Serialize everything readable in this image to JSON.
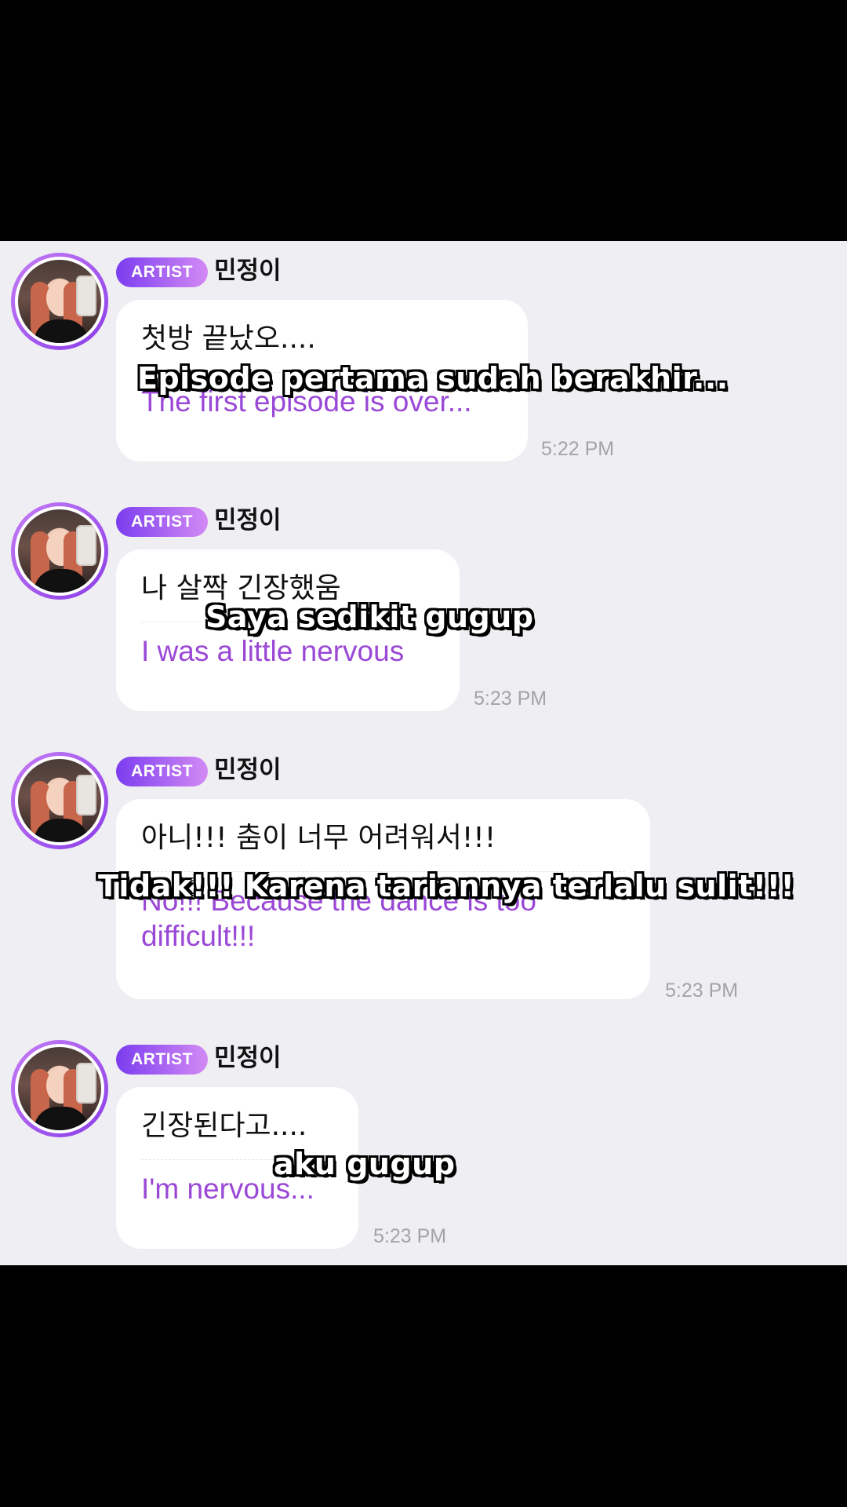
{
  "messages": [
    {
      "badge": "ARTIST",
      "name": "민정이",
      "korean": "첫방 끝났오....",
      "english": "The first episode is over...",
      "time": "5:22 PM",
      "subtitle": "Episode pertama sudah berakhir..."
    },
    {
      "badge": "ARTIST",
      "name": "민정이",
      "korean": "나 살짝 긴장했움",
      "english": "I was a little nervous",
      "time": "5:23 PM",
      "subtitle": "Saya sedikit gugup"
    },
    {
      "badge": "ARTIST",
      "name": "민정이",
      "korean": "아니!!! 춤이 너무 어려워서!!!",
      "english": "No!!! Because the dance is too difficult!!!",
      "time": "5:23 PM",
      "subtitle": "Tidak!!! Karena tariannya terlalu sulit!!!"
    },
    {
      "badge": "ARTIST",
      "name": "민정이",
      "korean": "긴장된다고....",
      "english": "I'm nervous...",
      "time": "5:23 PM",
      "subtitle": "aku gugup"
    }
  ],
  "colors": {
    "background": "#efeef3",
    "badge_start": "#7b3df0",
    "badge_end": "#d38af4",
    "translation": "#9a48d6",
    "timestamp": "#a3a3a8"
  }
}
